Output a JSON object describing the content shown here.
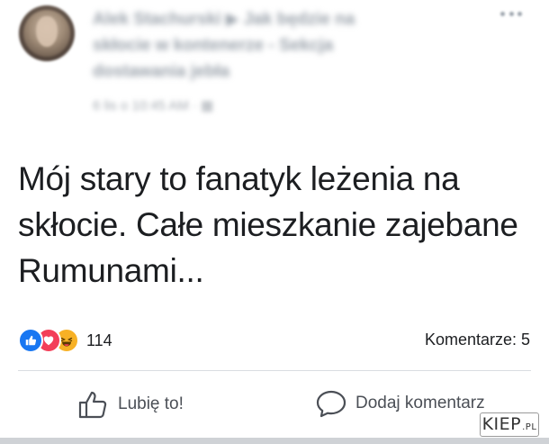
{
  "post": {
    "author": "Alek Stachurski ▶ Jak będzie na",
    "group_line2": "skłocie w kontenerze - Sekcja",
    "group_line3": "dostawania jebła",
    "meta": "6 lis o 10:45 AM · ▦",
    "body": "Mój stary to fanatyk leżenia na skłocie. Całe mieszkanie zajebane Rumunami...",
    "more_icon": "ellipsis-icon"
  },
  "reactions": {
    "icons": [
      "like-icon",
      "love-icon",
      "haha-icon"
    ],
    "count": "114",
    "colors": {
      "like": "#1877f2",
      "love": "#f33e58",
      "haha": "#f7b125"
    }
  },
  "comments": {
    "count_label": "Komentarze: 5"
  },
  "actions": {
    "like_label": "Lubię to!",
    "comment_label": "Dodaj komentarz"
  },
  "watermark": {
    "text": "KIEP",
    "suffix": ".PL"
  }
}
